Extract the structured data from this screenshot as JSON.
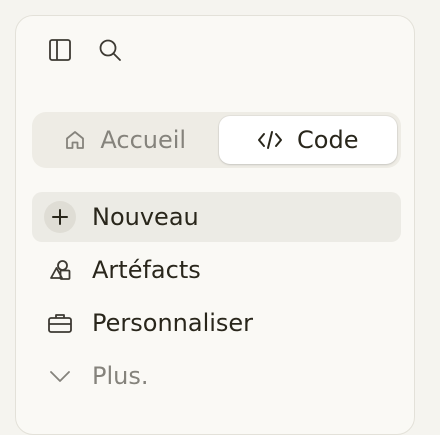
{
  "sidebar": {
    "top_icons": [
      "sidebar-toggle-icon",
      "search-icon"
    ],
    "mode_switch": {
      "home_label": "Accueil",
      "code_label": "Code",
      "active": "Code"
    },
    "nav": [
      {
        "label": "Nouveau",
        "icon": "plus-icon",
        "selected": true
      },
      {
        "label": "Artéfacts",
        "icon": "artifacts-icon"
      },
      {
        "label": "Personnaliser",
        "icon": "briefcase-icon"
      },
      {
        "label": "Plus.",
        "icon": "chevron-down-icon"
      }
    ]
  },
  "colors": {
    "background": "#faf9f5",
    "text": "#29261b",
    "muted": "#85837c",
    "selected_bg": "#ecebe5"
  }
}
